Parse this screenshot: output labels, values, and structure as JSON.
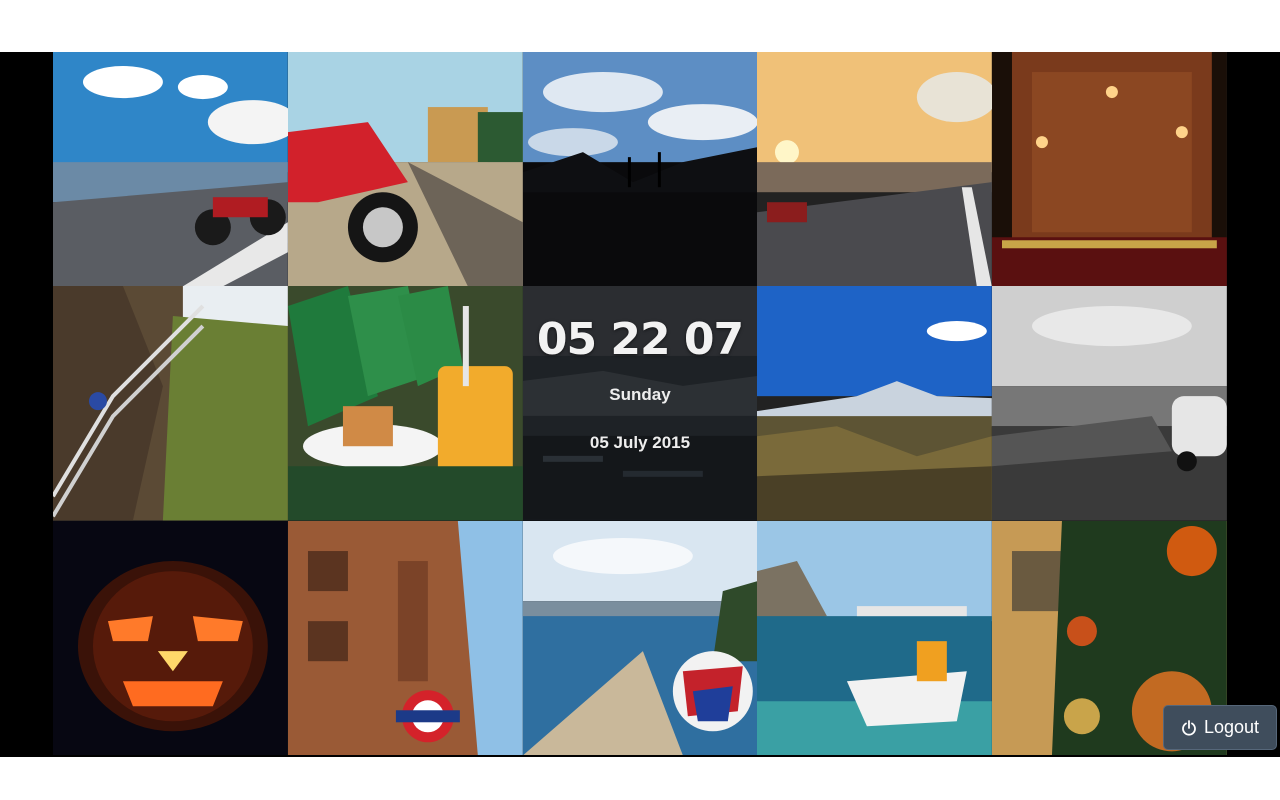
{
  "clock": {
    "time": "05 22 07",
    "day": "Sunday",
    "date": "05 July 2015"
  },
  "logout": {
    "label": "Logout",
    "icon": "power-icon"
  },
  "tiles": [
    {
      "subject": "motorcycle-on-mountain-road"
    },
    {
      "subject": "motorcycle-at-railway-station"
    },
    {
      "subject": "silhouette-palm-trees-cloudy-sky"
    },
    {
      "subject": "sunset-road-with-motorcycle"
    },
    {
      "subject": "temple-bar-pub-night"
    },
    {
      "subject": "rope-bridge-cliffs"
    },
    {
      "subject": "deck-chairs-cake-orange-juice"
    },
    {
      "subject": "mountain-volcano-valley"
    },
    {
      "subject": "black-white-beach-boat-fiat"
    },
    {
      "subject": "halloween-pumpkin"
    },
    {
      "subject": "harrods-underground-sign"
    },
    {
      "subject": "coastline-helmet"
    },
    {
      "subject": "boat-in-clear-water"
    },
    {
      "subject": "christmas-tree-ornaments"
    }
  ]
}
